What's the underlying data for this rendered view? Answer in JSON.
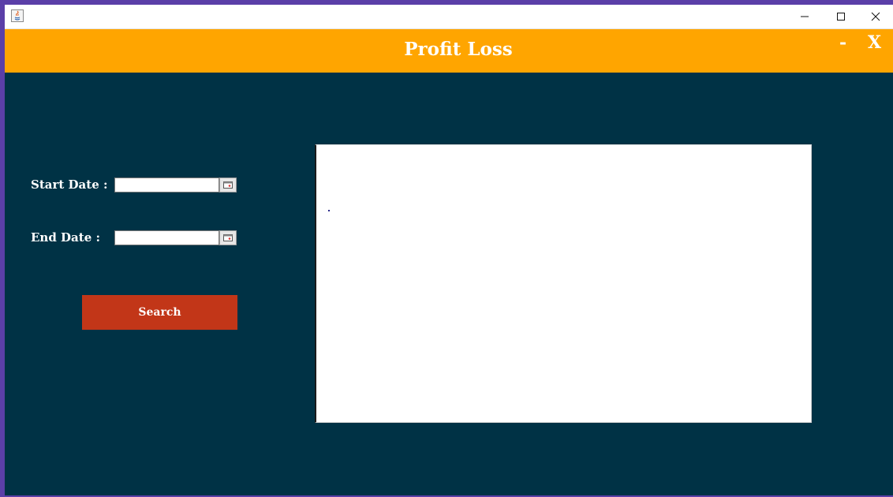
{
  "window": {
    "icon": "java-icon",
    "controls": {
      "minimize": "minimize-icon",
      "maximize": "maximize-icon",
      "close": "close-icon"
    }
  },
  "header": {
    "title": "Profit Loss",
    "min_label": "-",
    "close_label": "X",
    "background": "#ffa500"
  },
  "form": {
    "start_label": "Start Date :",
    "start_value": "",
    "end_label": "End Date :",
    "end_value": "",
    "calendar_icon": "calendar-icon",
    "search_label": "Search",
    "search_color": "#c23618"
  },
  "colors": {
    "panel": "#003245",
    "frame": "#5b3fa8"
  }
}
